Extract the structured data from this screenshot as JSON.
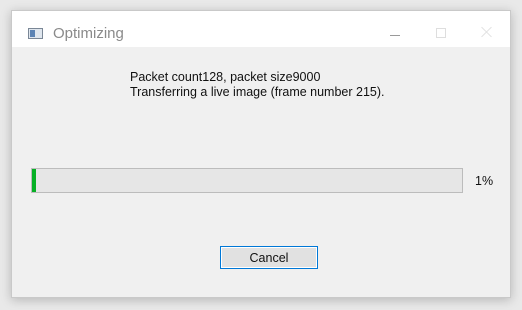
{
  "window": {
    "title": "Optimizing",
    "app_icon": "application-window-icon",
    "controls": {
      "minimize_icon": "minimize-icon",
      "maximize_icon": "maximize-icon",
      "close_icon": "close-icon"
    }
  },
  "message": {
    "line1": "Packet count128, packet size9000",
    "line2": "Transferring a live image (frame number 215)."
  },
  "progress": {
    "fraction": 0.01,
    "label": "1%",
    "fill_color": "#06b025"
  },
  "buttons": {
    "cancel_label": "Cancel",
    "focus_color": "#0078d7"
  }
}
